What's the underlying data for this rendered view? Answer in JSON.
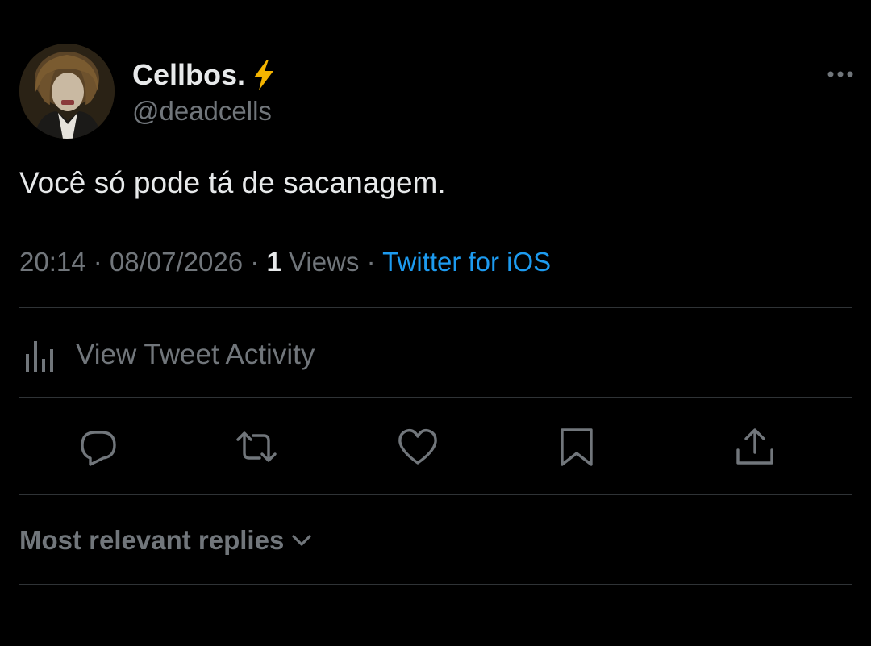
{
  "author": {
    "display_name": "Cellbos.",
    "handle": "@deadcells",
    "badge_icon": "lightning-bolt-icon",
    "badge_color": "#f4b400"
  },
  "tweet": {
    "text": "Você só pode tá de sacanagem.",
    "time": "20:14",
    "date": "08/07/2026",
    "views_count": "1",
    "views_label": "Views",
    "separator": "·",
    "source": "Twitter for iOS"
  },
  "activity": {
    "label": "View Tweet Activity",
    "icon": "bar-chart-icon"
  },
  "actions": [
    {
      "name": "reply",
      "icon": "reply-icon"
    },
    {
      "name": "retweet",
      "icon": "retweet-icon"
    },
    {
      "name": "like",
      "icon": "heart-icon"
    },
    {
      "name": "bookmark",
      "icon": "bookmark-icon"
    },
    {
      "name": "share",
      "icon": "share-icon"
    }
  ],
  "replies": {
    "label": "Most relevant replies",
    "icon": "chevron-down-icon"
  },
  "colors": {
    "background": "#000000",
    "primary_text": "#e7e9ea",
    "secondary_text": "#71767b",
    "link": "#1d9bf0",
    "divider": "#2f3336"
  }
}
